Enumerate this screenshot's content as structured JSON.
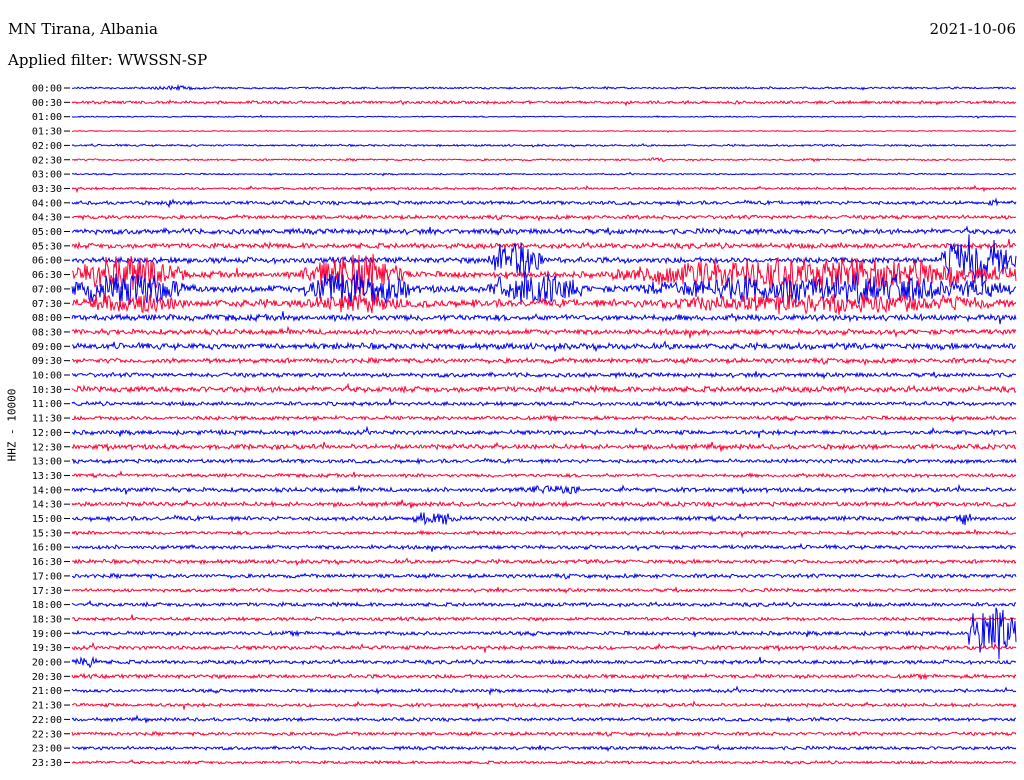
{
  "header": {
    "station": "MN Tirana, Albania",
    "date": "2021-10-06",
    "filter": "Applied filter: WWSSN-SP"
  },
  "chart_data": {
    "type": "line",
    "title": "MN Tirana, Albania",
    "subtitle": "Applied filter: WWSSN-SP",
    "date": "2021-10-06",
    "ylabel": "HHZ - 10000",
    "xlabel": "",
    "row_labels": [
      "00:00",
      "00:30",
      "01:00",
      "01:30",
      "02:00",
      "02:30",
      "03:00",
      "03:30",
      "04:00",
      "04:30",
      "05:00",
      "05:30",
      "06:00",
      "06:30",
      "07:00",
      "07:30",
      "08:00",
      "08:30",
      "09:00",
      "09:30",
      "10:00",
      "10:30",
      "11:00",
      "11:30",
      "12:00",
      "12:30",
      "13:00",
      "13:30",
      "14:00",
      "14:30",
      "15:00",
      "15:30",
      "16:00",
      "16:30",
      "17:00",
      "17:30",
      "18:00",
      "18:30",
      "19:00",
      "19:30",
      "20:00",
      "20:30",
      "21:00",
      "21:30",
      "22:00",
      "22:30",
      "23:00",
      "23:30"
    ],
    "trace_colors": [
      "#0000ee",
      "#ff0033"
    ],
    "noise_level": [
      0.8,
      1.2,
      0.5,
      0.4,
      0.8,
      0.8,
      0.6,
      1.0,
      1.5,
      1.6,
      2.2,
      2.2,
      2.4,
      2.6,
      3.0,
      3.2,
      2.5,
      2.2,
      2.5,
      2.0,
      1.8,
      2.4,
      1.6,
      1.6,
      1.8,
      2.0,
      1.6,
      1.4,
      1.8,
      1.8,
      1.8,
      1.4,
      1.6,
      1.6,
      1.6,
      1.4,
      1.6,
      1.4,
      1.6,
      1.6,
      1.6,
      1.6,
      1.4,
      1.4,
      1.4,
      1.4,
      1.4,
      1.2
    ],
    "events": [
      {
        "row": 0,
        "x": 0.08,
        "width": 0.06,
        "amp": 3
      },
      {
        "row": 5,
        "x": 0.61,
        "width": 0.02,
        "amp": 3
      },
      {
        "row": 8,
        "x": 0.1,
        "width": 0.01,
        "amp": 5
      },
      {
        "row": 8,
        "x": 0.97,
        "width": 0.01,
        "amp": 5
      },
      {
        "row": 12,
        "x": 0.44,
        "width": 0.06,
        "amp": 30
      },
      {
        "row": 12,
        "x": 0.92,
        "width": 0.08,
        "amp": 30
      },
      {
        "row": 13,
        "x": 0.0,
        "width": 0.12,
        "amp": 22
      },
      {
        "row": 13,
        "x": 0.24,
        "width": 0.12,
        "amp": 25
      },
      {
        "row": 13,
        "x": 0.57,
        "width": 0.43,
        "amp": 20
      },
      {
        "row": 14,
        "x": 0.0,
        "width": 0.12,
        "amp": 22
      },
      {
        "row": 14,
        "x": 0.24,
        "width": 0.12,
        "amp": 22
      },
      {
        "row": 14,
        "x": 0.44,
        "width": 0.1,
        "amp": 20
      },
      {
        "row": 14,
        "x": 0.6,
        "width": 0.4,
        "amp": 18
      },
      {
        "row": 15,
        "x": 0.0,
        "width": 0.12,
        "amp": 14
      },
      {
        "row": 15,
        "x": 0.24,
        "width": 0.12,
        "amp": 12
      },
      {
        "row": 15,
        "x": 0.6,
        "width": 0.4,
        "amp": 12
      },
      {
        "row": 28,
        "x": 0.48,
        "width": 0.06,
        "amp": 8
      },
      {
        "row": 30,
        "x": 0.36,
        "width": 0.05,
        "amp": 10
      },
      {
        "row": 30,
        "x": 0.94,
        "width": 0.01,
        "amp": 10
      },
      {
        "row": 38,
        "x": 0.95,
        "width": 0.05,
        "amp": 40
      },
      {
        "row": 40,
        "x": 0.0,
        "width": 0.03,
        "amp": 7
      },
      {
        "row": 44,
        "x": 0.79,
        "width": 0.01,
        "amp": 5
      }
    ]
  }
}
